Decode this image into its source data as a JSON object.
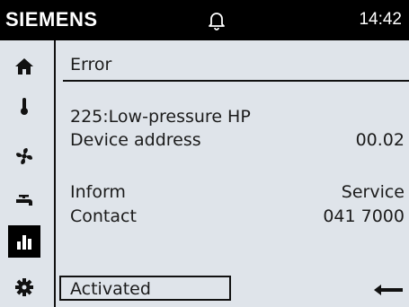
{
  "header": {
    "brand": "SIEMENS",
    "time": "14:42",
    "bell_icon": "bell-icon"
  },
  "sidebar": {
    "items": [
      {
        "name": "home",
        "icon": "home-icon",
        "active": false
      },
      {
        "name": "temperature",
        "icon": "thermometer-icon",
        "active": false
      },
      {
        "name": "fan",
        "icon": "fan-icon",
        "active": false
      },
      {
        "name": "water",
        "icon": "faucet-icon",
        "active": false
      },
      {
        "name": "statistics",
        "icon": "bar-chart-icon",
        "active": true
      },
      {
        "name": "settings",
        "icon": "gear-icon",
        "active": false
      }
    ]
  },
  "main": {
    "title": "Error",
    "error_code": "225:Low-pressure HP",
    "device_address_label": "Device address",
    "device_address_value": "00.02",
    "inform_label": "Inform",
    "inform_value": "Service",
    "contact_label": "Contact",
    "contact_value": "041 7000",
    "status_value": "Activated",
    "back_icon": "back-arrow-icon"
  },
  "colors": {
    "background": "#dfe4ea",
    "header": "#000000",
    "text": "#1b1b1b"
  }
}
